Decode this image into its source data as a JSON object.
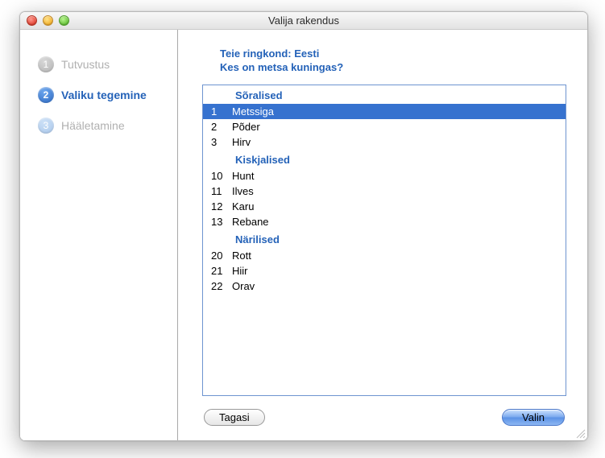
{
  "window": {
    "title": "Valija rakendus"
  },
  "sidebar": {
    "steps": [
      {
        "num": "1",
        "label": "Tutvustus",
        "state": "done"
      },
      {
        "num": "2",
        "label": "Valiku tegemine",
        "state": "active"
      },
      {
        "num": "3",
        "label": "Hääletamine",
        "state": "future"
      }
    ]
  },
  "main": {
    "region_label": "Teie ringkond:",
    "region_value": "Eesti",
    "question": "Kes on metsa kuningas?",
    "groups": [
      {
        "title": "Sõralised",
        "items": [
          {
            "num": "1",
            "label": "Metssiga",
            "selected": true
          },
          {
            "num": "2",
            "label": "Põder",
            "selected": false
          },
          {
            "num": "3",
            "label": "Hirv",
            "selected": false
          }
        ]
      },
      {
        "title": "Kiskjalised",
        "items": [
          {
            "num": "10",
            "label": "Hunt",
            "selected": false
          },
          {
            "num": "11",
            "label": "Ilves",
            "selected": false
          },
          {
            "num": "12",
            "label": "Karu",
            "selected": false
          },
          {
            "num": "13",
            "label": "Rebane",
            "selected": false
          }
        ]
      },
      {
        "title": "Närilised",
        "items": [
          {
            "num": "20",
            "label": "Rott",
            "selected": false
          },
          {
            "num": "21",
            "label": "Hiir",
            "selected": false
          },
          {
            "num": "22",
            "label": "Orav",
            "selected": false
          }
        ]
      }
    ],
    "back_label": "Tagasi",
    "select_label": "Valin"
  }
}
